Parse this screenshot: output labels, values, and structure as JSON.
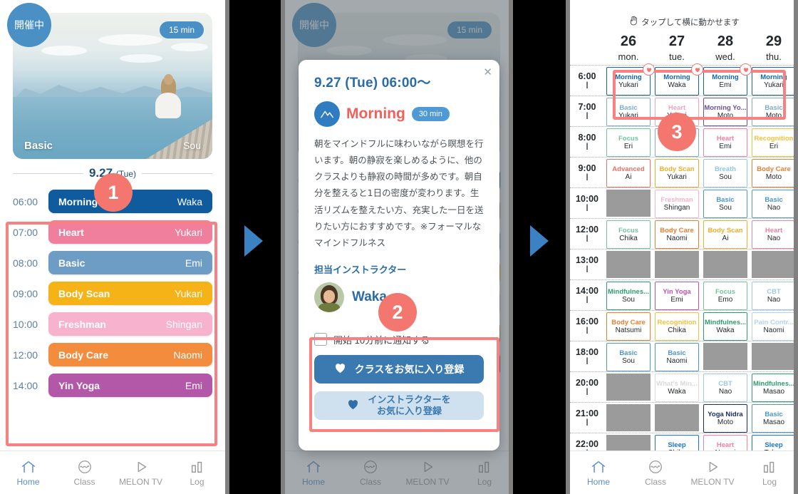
{
  "panel1": {
    "hero": {
      "live_badge": "開催中",
      "duration_badge": "15 min",
      "level": "Basic",
      "instructor": "Sou"
    },
    "date_label": "9.27",
    "date_day": "(Tue)",
    "schedule": [
      {
        "time": "06:00",
        "class": "Morning",
        "instructor": "Waka",
        "bg": "#0f5b9e",
        "fg": "#ffffff"
      },
      {
        "time": "07:00",
        "class": "Heart",
        "instructor": "Yukari",
        "bg": "#f07f9e",
        "fg": "#ffffff"
      },
      {
        "time": "08:00",
        "class": "Basic",
        "instructor": "Emi",
        "bg": "#6d9dc5",
        "fg": "#ffffff"
      },
      {
        "time": "09:00",
        "class": "Body Scan",
        "instructor": "Yukari",
        "bg": "#f5b318",
        "fg": "#ffffff"
      },
      {
        "time": "10:00",
        "class": "Freshman",
        "instructor": "Shingan",
        "bg": "#f7b3cd",
        "fg": "#ffffff"
      },
      {
        "time": "12:00",
        "class": "Body Care",
        "instructor": "Naomi",
        "bg": "#f38c3c",
        "fg": "#ffffff"
      },
      {
        "time": "14:00",
        "class": "Yin Yoga",
        "instructor": "Emi",
        "bg": "#b358a8",
        "fg": "#ffffff"
      }
    ]
  },
  "panel2": {
    "modal": {
      "close_icon": "close-icon",
      "title": "9.27 (Tue) 06:00〜",
      "class_name": "Morning",
      "duration": "30 min",
      "description": "朝をマインドフルに味わいながら瞑想を行います。朝の静寂を楽しめるように、他のクラスよりも静寂の時間が多めです。朝自分を整えると1日の密度が変わります。生活リズムを整えたい方、充実した一日を送りたい方におすすめです。※フォーマルなマインドフルネス",
      "section_label": "担当インストラクター",
      "instructor_name": "Waka",
      "notify_label": "開始 10分前に通知する",
      "notify_checked": false,
      "btn_favorite_class": "クラスをお気に入り登録",
      "btn_favorite_instructor_line1": "インストラクターを",
      "btn_favorite_instructor_line2": "お気に入り登録"
    }
  },
  "panel3": {
    "tip": "タップして横に動かせます",
    "days": [
      {
        "num": "26",
        "name": "mon."
      },
      {
        "num": "27",
        "name": "tue."
      },
      {
        "num": "28",
        "name": "wed."
      },
      {
        "num": "29",
        "name": "thu."
      }
    ],
    "times": [
      "6:00",
      "7:00",
      "8:00",
      "9:00",
      "10:00",
      "12:00",
      "13:00",
      "14:00",
      "16:00",
      "18:00",
      "20:00",
      "21:00",
      "22:00"
    ],
    "grid": [
      [
        {
          "class": "Morning",
          "instructor": "Yukari",
          "color": "#1565a8",
          "favorite": true
        },
        {
          "class": "Morning",
          "instructor": "Waka",
          "color": "#1565a8",
          "favorite": true
        },
        {
          "class": "Morning",
          "instructor": "Emi",
          "color": "#1565a8",
          "favorite": true
        },
        {
          "class": "Morning",
          "instructor": "Yukari",
          "color": "#1565a8",
          "favorite": false
        }
      ],
      [
        {
          "class": "Basic",
          "instructor": "Yukari",
          "color": "#7dadd4",
          "favorite": false
        },
        {
          "class": "Heart",
          "instructor": "Yukari",
          "color": "#f5a3bb",
          "favorite": false
        },
        {
          "class": "Morning Yo...",
          "instructor": "Moto",
          "color": "#6b4f9e",
          "favorite": false
        },
        {
          "class": "Basic",
          "instructor": "Moto",
          "color": "#7dadd4",
          "favorite": false
        }
      ],
      [
        {
          "class": "Focus",
          "instructor": "Eri",
          "color": "#73c49a",
          "favorite": false
        },
        {
          "class": "",
          "instructor": "",
          "color": "#7dadd4",
          "favorite": false
        },
        {
          "class": "Heart",
          "instructor": "Emi",
          "color": "#f5809f",
          "favorite": false
        },
        {
          "class": "Recognition",
          "instructor": "Eri",
          "color": "#f2c23c",
          "favorite": false
        }
      ],
      [
        {
          "class": "Advanced",
          "instructor": "Ai",
          "color": "#ef6f63",
          "favorite": false
        },
        {
          "class": "Body Scan",
          "instructor": "Yukari",
          "color": "#f0ad28",
          "favorite": false
        },
        {
          "class": "Breath",
          "instructor": "Sou",
          "color": "#8cc9e8",
          "favorite": false
        },
        {
          "class": "Body Care",
          "instructor": "Moto",
          "color": "#f07c2c",
          "favorite": false
        }
      ],
      [
        null,
        {
          "class": "Freshman",
          "instructor": "Shingan",
          "color": "#f7b3cd",
          "favorite": false
        },
        {
          "class": "Basic",
          "instructor": "Sou",
          "color": "#4e95d4",
          "favorite": false
        },
        {
          "class": "Basic",
          "instructor": "Nao",
          "color": "#4e95d4",
          "favorite": false
        }
      ],
      [
        {
          "class": "Focus",
          "instructor": "Chika",
          "color": "#73c49a",
          "favorite": false
        },
        {
          "class": "Body Care",
          "instructor": "Naomi",
          "color": "#f07c2c",
          "favorite": false
        },
        {
          "class": "Body Scan",
          "instructor": "Ai",
          "color": "#f0ad28",
          "favorite": false
        },
        {
          "class": "Heart",
          "instructor": "Nao",
          "color": "#f5809f",
          "favorite": false
        }
      ],
      [
        null,
        null,
        null,
        null
      ],
      [
        {
          "class": "Mindfulnes...",
          "instructor": "Sou",
          "color": "#2f9e6e",
          "favorite": false
        },
        {
          "class": "Yin Yoga",
          "instructor": "Emi",
          "color": "#c34fae",
          "favorite": false
        },
        {
          "class": "Focus",
          "instructor": "Emo",
          "color": "#73c49a",
          "favorite": false
        },
        {
          "class": "CBT",
          "instructor": "Nao",
          "color": "#9ec6e8",
          "favorite": false
        }
      ],
      [
        {
          "class": "Body Care",
          "instructor": "Natsumi",
          "color": "#f07c2c",
          "favorite": false
        },
        {
          "class": "Recognition",
          "instructor": "Chika",
          "color": "#f2c23c",
          "favorite": false
        },
        {
          "class": "Mindfulnes...",
          "instructor": "Waka",
          "color": "#2f9e6e",
          "favorite": false
        },
        {
          "class": "Pain Contr...",
          "instructor": "Naomi",
          "color": "#b4d3ee",
          "favorite": false
        }
      ],
      [
        {
          "class": "Basic",
          "instructor": "Sou",
          "color": "#4e95d4",
          "favorite": false
        },
        {
          "class": "Basic",
          "instructor": "Naomi",
          "color": "#4e95d4",
          "favorite": false
        },
        null,
        null
      ],
      [
        null,
        {
          "class": "What's Min...",
          "instructor": "Waka",
          "color": "#d8dadc",
          "favorite": false
        },
        {
          "class": "CBT",
          "instructor": "Nao",
          "color": "#9ec6e8",
          "favorite": false
        },
        {
          "class": "Mindfulnes...",
          "instructor": "Masao",
          "color": "#2f9e6e",
          "favorite": false
        }
      ],
      [
        null,
        null,
        {
          "class": "Yoga Nidra",
          "instructor": "Moto",
          "color": "#1a2a6c",
          "favorite": false
        },
        {
          "class": "Basic",
          "instructor": "Masao",
          "color": "#4e95d4",
          "favorite": false
        }
      ],
      [
        null,
        {
          "class": "Sleep",
          "instructor": "Chika",
          "color": "#1976c4",
          "favorite": false
        },
        {
          "class": "Heart",
          "instructor": "Naomi",
          "color": "#f5809f",
          "favorite": false
        },
        {
          "class": "Sleep",
          "instructor": "Takae",
          "color": "#1976c4",
          "favorite": false
        }
      ]
    ]
  },
  "nav": {
    "items": [
      {
        "label": "Home",
        "icon": "home-icon",
        "active": true
      },
      {
        "label": "Class",
        "icon": "class-icon",
        "active": false
      },
      {
        "label": "MELON TV",
        "icon": "play-icon",
        "active": false
      },
      {
        "label": "Log",
        "icon": "chart-icon",
        "active": false
      }
    ]
  },
  "steps": {
    "one": "1",
    "two": "2",
    "three": "3"
  },
  "colors": {
    "accent_red": "#f4776f",
    "brand_blue": "#3b7ab0"
  }
}
